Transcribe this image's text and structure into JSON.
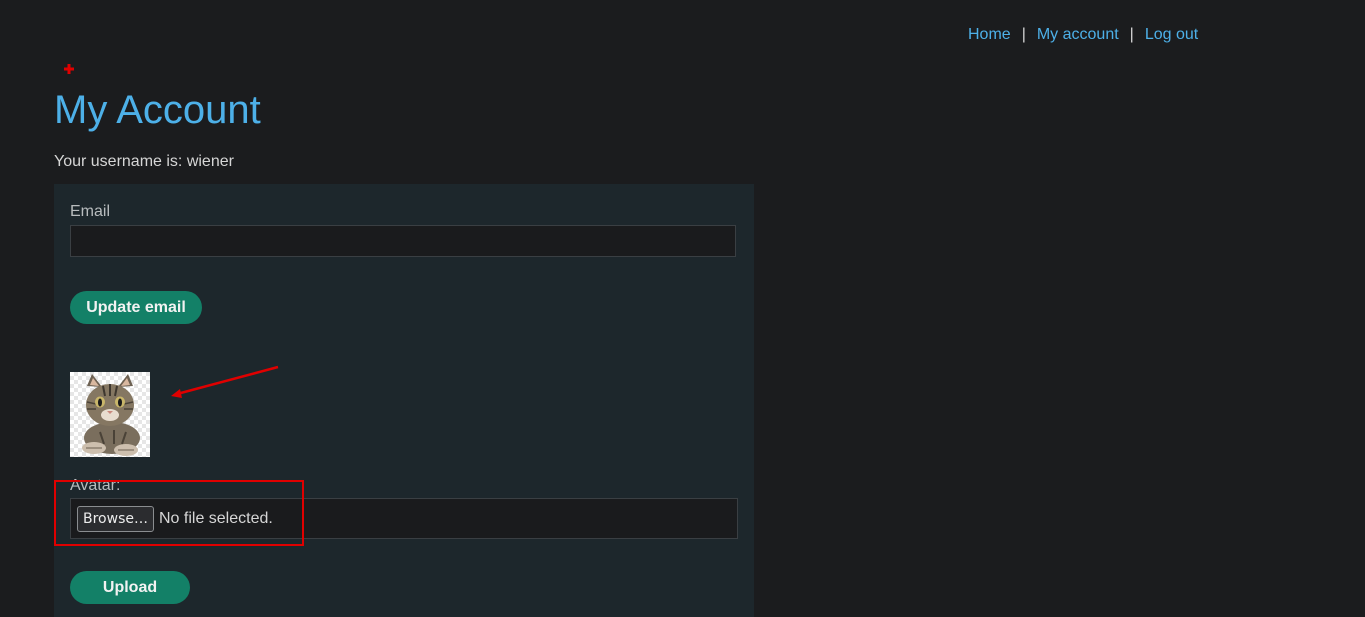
{
  "nav": {
    "home": "Home",
    "sep1": "|",
    "my_account": "My account",
    "sep2": "|",
    "log_out": "Log out"
  },
  "page": {
    "title": "My Account",
    "username_text": "Your username is: wiener"
  },
  "email_form": {
    "label": "Email",
    "value": "",
    "button": "Update email"
  },
  "avatar_form": {
    "label": "Avatar:",
    "browse_button": "Browse…",
    "file_status": "No file selected.",
    "upload_button": "Upload"
  },
  "colors": {
    "accent_link": "#4db0e8",
    "button_green": "#138067",
    "annotation_red": "#e00000",
    "background": "#1b1c1e",
    "panel": "#1d272c"
  },
  "icons": [
    "red-cross-icon",
    "cat-avatar-image",
    "red-arrow-annotation"
  ]
}
